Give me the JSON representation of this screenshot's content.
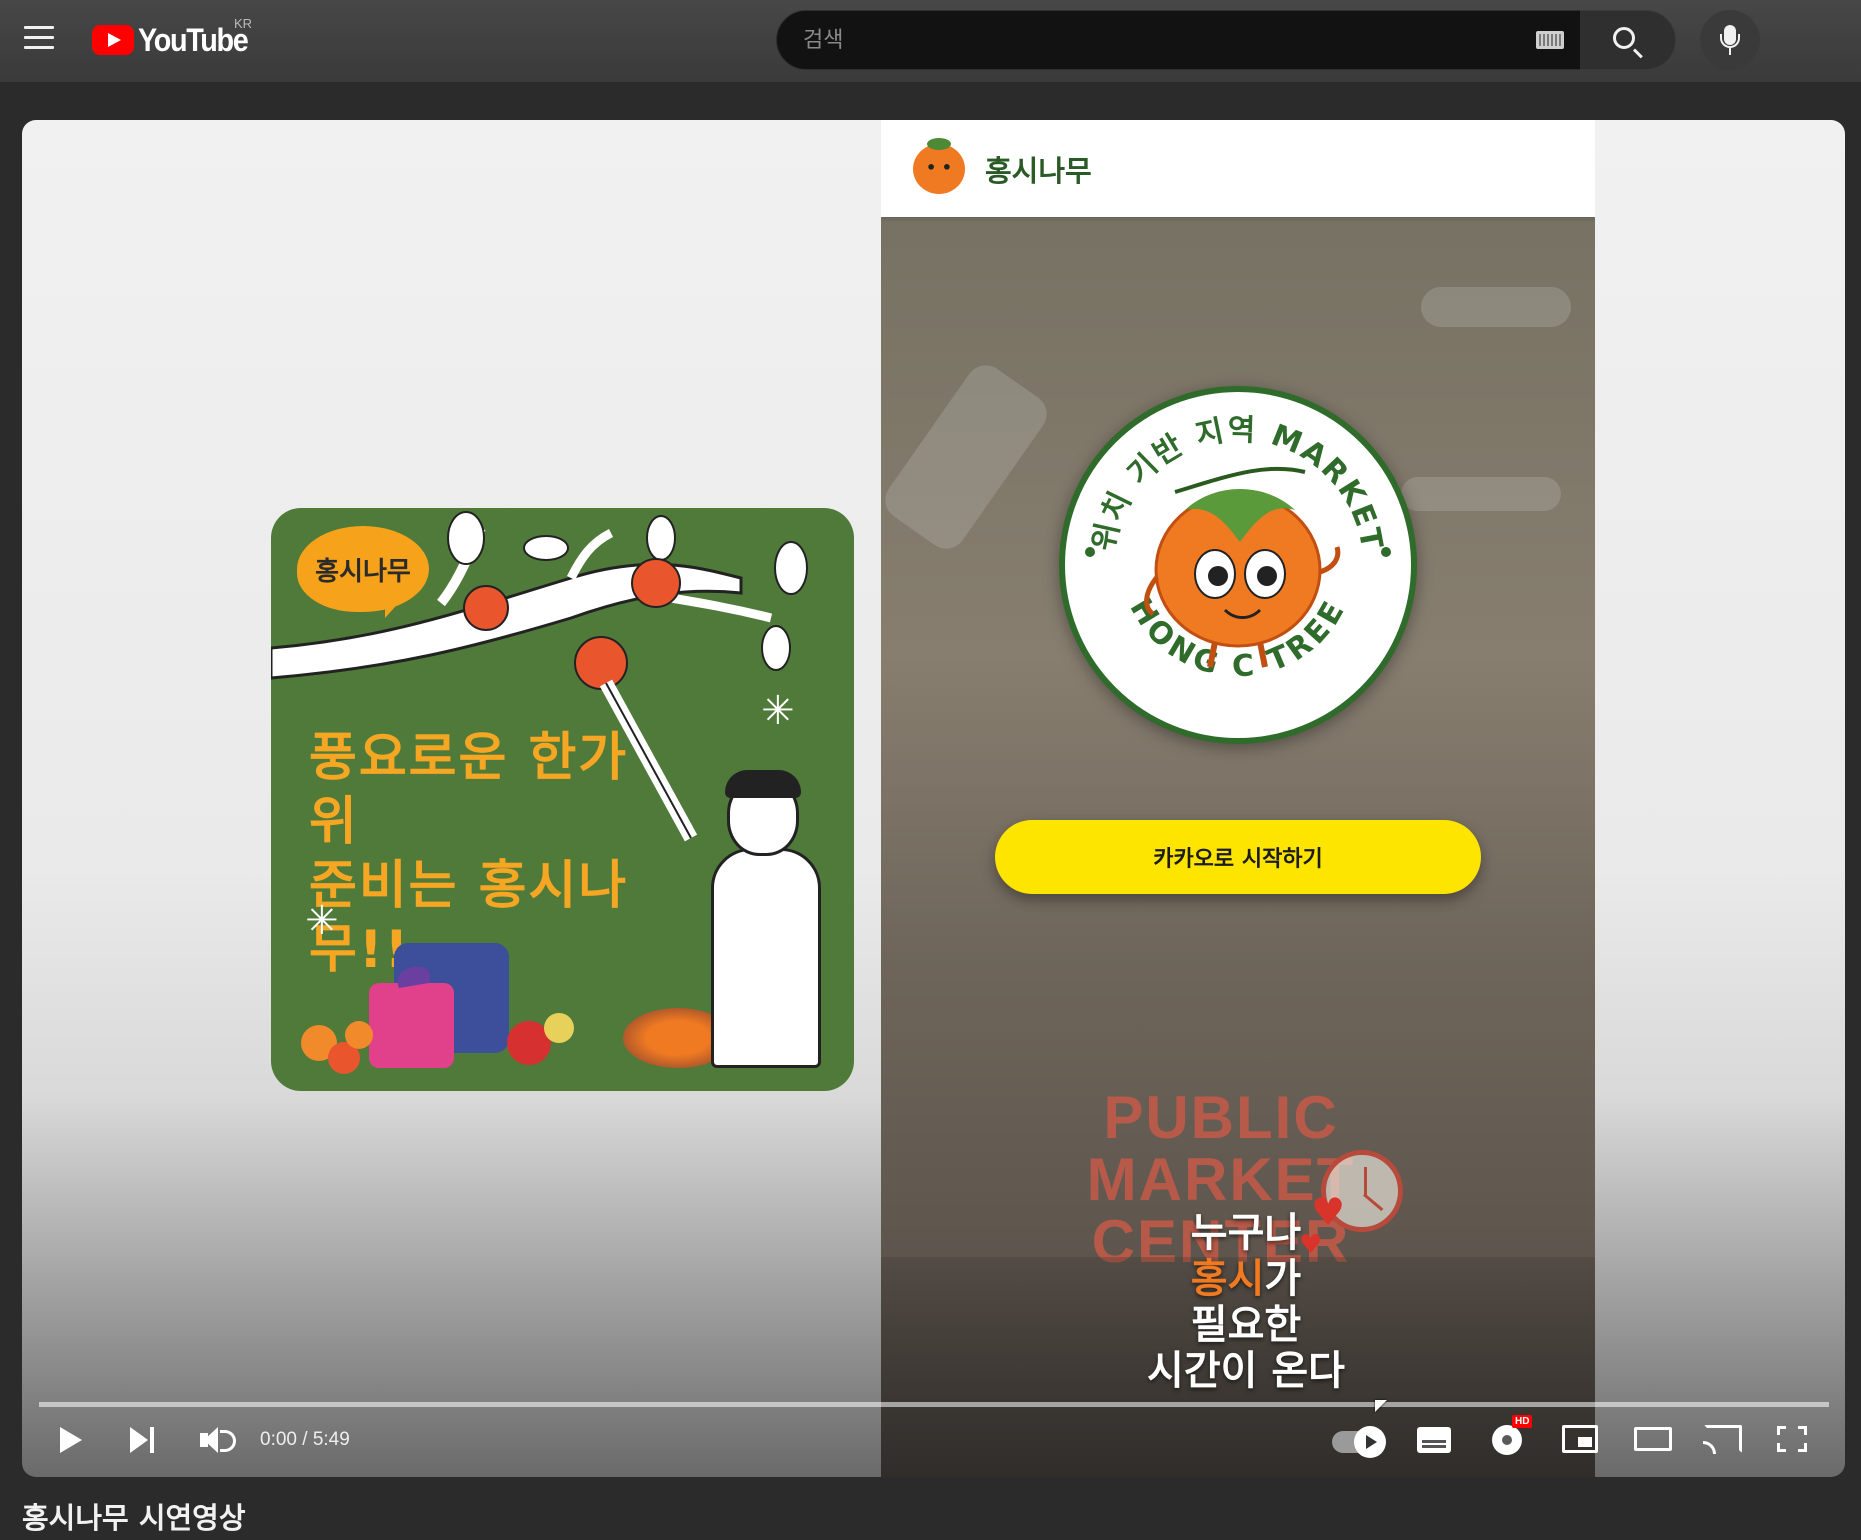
{
  "header": {
    "logo_text": "YouTube",
    "country_code": "KR",
    "search_placeholder": "검색"
  },
  "video": {
    "promo": {
      "bubble_text": "홍시나무",
      "headline_line1": "풍요로운 한가위",
      "headline_line2": "준비는 홍시나무!!"
    },
    "phone": {
      "app_title": "홍시나무",
      "badge_top_text": "위치 기반 지역 MARKET",
      "badge_bottom_text": "HONG C TREE",
      "kakao_button_label": "카카오로 시작하기",
      "sign_line1": "PUBLIC",
      "sign_line2": "MARKET",
      "sign_line3": "CENTER",
      "slogan_line1": "누구나",
      "slogan_line2_accent": "홍시",
      "slogan_line2_rest": "가",
      "slogan_line3": "필요한",
      "slogan_line4": "시간이 온다"
    },
    "progress_percent": 0
  },
  "controls": {
    "time_display": "0:00 / 5:49",
    "hd_label": "HD"
  },
  "page": {
    "video_title": "홍시나무 시연영상"
  },
  "colors": {
    "youtube_red": "#ff0000",
    "kakao_yellow": "#fee500",
    "promo_green": "#4f7a3a",
    "persimmon_orange": "#f07a22"
  }
}
